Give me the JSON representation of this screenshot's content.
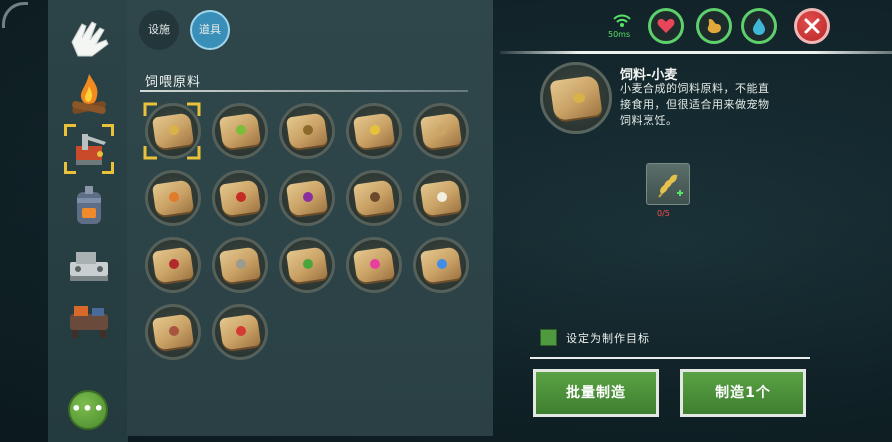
{
  "tabs": [
    {
      "label": "设施"
    },
    {
      "label": "道具"
    }
  ],
  "section_title": "饲喂原料",
  "status": {
    "ping": "50ms"
  },
  "detail": {
    "name": "饲料-小麦",
    "description": "小麦合成的饲料原料，不能直接食用，但很适合用来做宠物饲料烹饪。",
    "ingredient_count": "0/5"
  },
  "target_label": "设定为制作目标",
  "buttons": {
    "batch": "批量制造",
    "one": "制造1个"
  },
  "more_label": "•••",
  "colors": {
    "accent_green": "#5aa245",
    "selected_tab": "#3a8fb8",
    "count_red": "#ff4b4b",
    "ping_green": "#57e266"
  },
  "items": [
    {
      "icon": "wheat-feed-icon",
      "color": "#d9b24a"
    },
    {
      "icon": "vegetable-feed-icon",
      "color": "#7bbd3b"
    },
    {
      "icon": "potato-feed-icon",
      "color": "#8c6a2c"
    },
    {
      "icon": "corn-feed-icon",
      "color": "#e6c23a"
    },
    {
      "icon": "grain-feed-icon",
      "color": "#caa567"
    },
    {
      "icon": "carrot-feed-icon",
      "color": "#e07b2a"
    },
    {
      "icon": "pepper-feed-icon",
      "color": "#c62b25"
    },
    {
      "icon": "onion-feed-icon",
      "color": "#8a2fa0"
    },
    {
      "icon": "seed-feed-icon",
      "color": "#6b4a2c"
    },
    {
      "icon": "flower-white-feed-icon",
      "color": "#f1efe0"
    },
    {
      "icon": "berry-feed-icon",
      "color": "#b22a2a"
    },
    {
      "icon": "herb-feed-icon",
      "color": "#9b9b8f"
    },
    {
      "icon": "cabbage-feed-icon",
      "color": "#4aa63a"
    },
    {
      "icon": "flower-pink-feed-icon",
      "color": "#e83f9e"
    },
    {
      "icon": "flower-blue-feed-icon",
      "color": "#3f8de8"
    },
    {
      "icon": "mushroom-feed-icon",
      "color": "#a8553f"
    },
    {
      "icon": "strawberry-feed-icon",
      "color": "#d63a35"
    }
  ]
}
